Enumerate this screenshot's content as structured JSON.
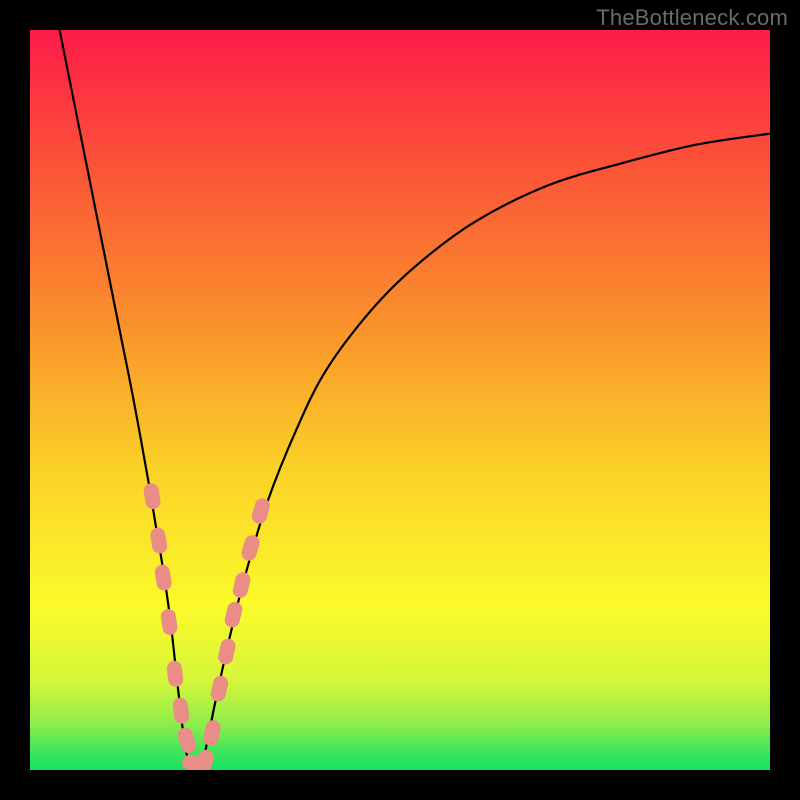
{
  "watermark": "TheBottleneck.com",
  "chart_data": {
    "type": "line",
    "title": "",
    "xlabel": "",
    "ylabel": "",
    "xlim": [
      0,
      100
    ],
    "ylim": [
      0,
      100
    ],
    "grid": false,
    "legend": null,
    "series": [
      {
        "name": "bottleneck-curve",
        "x": [
          4,
          6,
          8,
          10,
          12,
          14,
          16,
          17,
          18,
          19,
          20,
          21,
          22,
          23,
          24,
          25,
          27,
          29,
          32,
          36,
          40,
          46,
          52,
          60,
          70,
          80,
          90,
          100
        ],
        "y": [
          100,
          90,
          80,
          70,
          60,
          50,
          39,
          33,
          27,
          20,
          11,
          3,
          0,
          0,
          4,
          9,
          18,
          26,
          36,
          46,
          54,
          62,
          68,
          74,
          79,
          82,
          84.5,
          86
        ]
      }
    ],
    "markers": {
      "name": "highlight-dots",
      "color": "#e98d86",
      "points": [
        {
          "x": 16.5,
          "y": 37
        },
        {
          "x": 17.4,
          "y": 31
        },
        {
          "x": 18.0,
          "y": 26
        },
        {
          "x": 18.8,
          "y": 20
        },
        {
          "x": 19.6,
          "y": 13
        },
        {
          "x": 20.4,
          "y": 8
        },
        {
          "x": 21.2,
          "y": 4
        },
        {
          "x": 22.3,
          "y": 1
        },
        {
          "x": 23.6,
          "y": 1
        },
        {
          "x": 24.6,
          "y": 5
        },
        {
          "x": 25.6,
          "y": 11
        },
        {
          "x": 26.6,
          "y": 16
        },
        {
          "x": 27.5,
          "y": 21
        },
        {
          "x": 28.6,
          "y": 25
        },
        {
          "x": 29.8,
          "y": 30
        },
        {
          "x": 31.2,
          "y": 35
        }
      ]
    },
    "background_gradient": {
      "stops": [
        {
          "offset": 0.0,
          "color": "#fd1c49"
        },
        {
          "offset": 0.18,
          "color": "#fb5237"
        },
        {
          "offset": 0.4,
          "color": "#f9922c"
        },
        {
          "offset": 0.6,
          "color": "#fbd328"
        },
        {
          "offset": 0.78,
          "color": "#fbfb2b"
        },
        {
          "offset": 0.88,
          "color": "#d5f53b"
        },
        {
          "offset": 0.94,
          "color": "#8bed4a"
        },
        {
          "offset": 0.975,
          "color": "#3fe55b"
        },
        {
          "offset": 1.0,
          "color": "#17e064"
        }
      ]
    }
  }
}
